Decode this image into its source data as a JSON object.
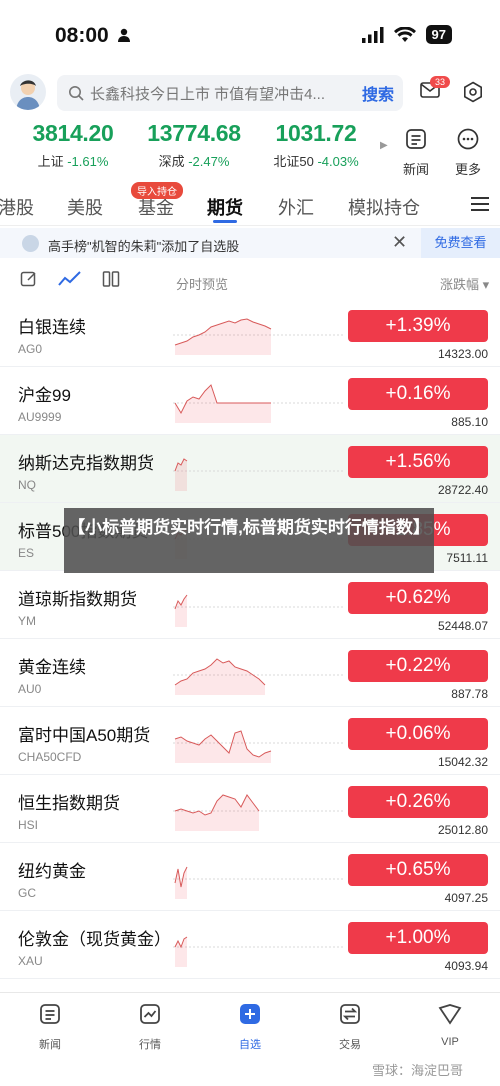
{
  "status": {
    "time": "08:00",
    "battery": "97"
  },
  "search": {
    "placeholder": "长鑫科技今日上市 市值有望冲击4...",
    "button": "搜索",
    "badge": "33"
  },
  "indices": [
    {
      "value": "3814.20",
      "name": "上证",
      "change": "-1.61%"
    },
    {
      "value": "13774.68",
      "name": "深成",
      "change": "-2.47%"
    },
    {
      "value": "1031.72",
      "name": "北证50",
      "change": "-4.03%"
    }
  ],
  "quick": {
    "news": "新闻",
    "more": "更多"
  },
  "tabs": [
    "港股",
    "美股",
    "基金",
    "期货",
    "外汇",
    "模拟持仓"
  ],
  "tab_badge": "导入持仓",
  "notice": {
    "text": "高手榜\"机智的朱莉\"添加了自选股",
    "button": "免费查看"
  },
  "toolbar": {
    "col1": "分时预览",
    "col2": "涨跌幅 ▾"
  },
  "rows": [
    {
      "name": "白银连续",
      "code": "AG0",
      "pct": "+1.39%",
      "price": "14323.00",
      "points": [
        40,
        38,
        36,
        32,
        30,
        27,
        22,
        20,
        18,
        16,
        18,
        15,
        14,
        17,
        19,
        21,
        24
      ]
    },
    {
      "name": "沪金99",
      "code": "AU9999",
      "pct": "+0.16%",
      "price": "885.10",
      "points": [
        30,
        40,
        28,
        24,
        26,
        18,
        12,
        30,
        30,
        30,
        30,
        30,
        30,
        30,
        30,
        30,
        30
      ]
    },
    {
      "name": "纳斯达克指数期货",
      "code": "NQ",
      "pct": "+1.56%",
      "price": "28722.40",
      "points": [
        30,
        22,
        24,
        18,
        20
      ]
    },
    {
      "name": "标普500指数期货",
      "code": "ES",
      "pct": "+1.85%",
      "price": "7511.11",
      "points": [
        30,
        24,
        26,
        20,
        22
      ]
    },
    {
      "name": "道琼斯指数期货",
      "code": "YM",
      "pct": "+0.62%",
      "price": "52448.07",
      "points": [
        32,
        24,
        28,
        22,
        18
      ]
    },
    {
      "name": "黄金连续",
      "code": "AU0",
      "pct": "+0.22%",
      "price": "887.78",
      "points": [
        40,
        36,
        34,
        28,
        26,
        24,
        20,
        14,
        18,
        16,
        22,
        24,
        26,
        30,
        34,
        40
      ]
    },
    {
      "name": "富时中国A50期货",
      "code": "CHA50CFD",
      "pct": "+0.06%",
      "price": "15042.32",
      "points": [
        26,
        24,
        28,
        30,
        32,
        26,
        22,
        28,
        34,
        40,
        20,
        18,
        36,
        42,
        44,
        40,
        38
      ]
    },
    {
      "name": "恒生指数期货",
      "code": "HSI",
      "pct": "+0.26%",
      "price": "25012.80",
      "points": [
        30,
        28,
        30,
        32,
        30,
        34,
        32,
        20,
        14,
        16,
        18,
        26,
        14,
        22,
        30
      ]
    },
    {
      "name": "纽约黄金",
      "code": "GC",
      "pct": "+0.65%",
      "price": "4097.25",
      "points": [
        34,
        20,
        38,
        24,
        18
      ]
    },
    {
      "name": "伦敦金（现货黄金）",
      "code": "XAU",
      "pct": "+1.00%",
      "price": "4093.94",
      "points": [
        30,
        24,
        30,
        22,
        20
      ]
    }
  ],
  "overlay": "【小标普期货实时行情,标普期货实时行情指数】",
  "nav": [
    "新闻",
    "行情",
    "自选",
    "交易",
    "VIP"
  ],
  "watermark": "雪球：海淀巴哥",
  "colors": {
    "up": "#ef3a4a",
    "down": "#18a05a",
    "accent": "#2f6ae3"
  }
}
